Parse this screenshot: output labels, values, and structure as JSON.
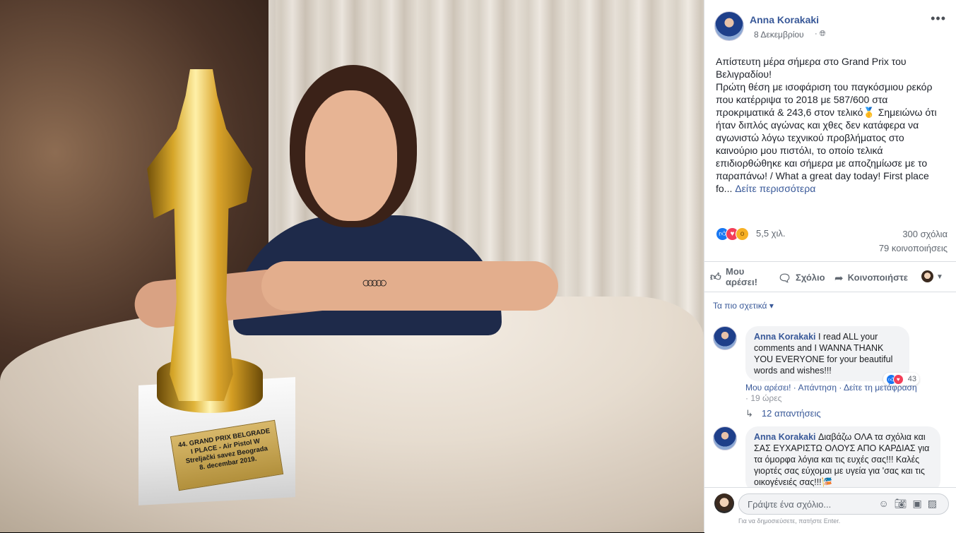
{
  "photo": {
    "plaque_lines": [
      "44. GRAND PRIX BELGRADE",
      "I PLACE - Air Pistol W",
      "Streljački savez Beograda",
      "8. decembar 2019."
    ]
  },
  "post": {
    "author": "Anna Korakaki",
    "date": "8 Δεκεμβρίου",
    "privacy_icon": "globe-icon",
    "text": "Απίστευτη μέρα σήμερα στο Grand Prix του Βελιγραδίου!\nΠρώτη θέση με ισοφάριση του παγκόσμιου ρεκόρ που κατέρριψα το 2018 με 587/600 στα προκριματικά & 243,6 στον τελικό🥇 Σημειώνω ότι ήταν διπλός αγώνας και χθες δεν κατάφερα να αγωνιστώ λόγω τεχνικού προβλήματος στο καινούριο μου πιστόλι, το οποίο τελικά επιδιορθώθηκε και σήμερα με αποζημίωσε με το παραπάνω! / What a great day today! First place fo...",
    "see_more": "Δείτε περισσότερα",
    "reactions_count": "5,5 χιλ.",
    "comments_count": "300 σχόλια",
    "shares_count": "79 κοινοποιήσεις",
    "actions": {
      "like": "Μου αρέσει!",
      "comment": "Σχόλιο",
      "share": "Κοινοποιήστε"
    },
    "sort_label": "Τα πιο σχετικά"
  },
  "comments": [
    {
      "author": "Anna Korakaki",
      "text": "I read ALL your comments and I WANNA THANK YOU EVERYONE for your beautiful words and wishes!!!",
      "reactions": "43",
      "like": "Μου αρέσει!",
      "reply": "Απάντηση",
      "translate": "Δείτε τη μετάφραση",
      "time": "19 ώρες",
      "replies": "12 απαντήσεις"
    },
    {
      "author": "Anna Korakaki",
      "text": "Διαβάζω ΟΛΑ τα σχόλια και ΣΑΣ ΕΥΧΑΡΙΣΤΩ ΟΛΟΥΣ ΑΠΟ ΚΑΡΔΙΑΣ για τα όμορφα λόγια και τις ευχές σας!!! Καλές γιορτές σας εύχομαι με υγεία για 'σας και τις οικογένειές σας!!!🎏"
    }
  ],
  "composer": {
    "placeholder": "Γράψτε ένα σχόλιο...",
    "hint": "Για να δημοσιεύσετε, πατήστε Enter."
  }
}
